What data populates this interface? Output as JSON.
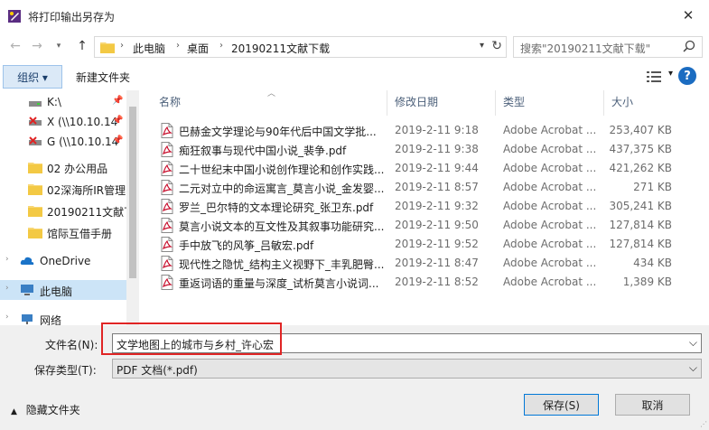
{
  "window": {
    "title": "将打印输出另存为",
    "close_glyph": "✕"
  },
  "address": {
    "crumbs": [
      "此电脑",
      "桌面",
      "20190211文献下载"
    ],
    "search_placeholder": "搜索\"20190211文献下载\""
  },
  "toolbar": {
    "organize_label": "组织 ▾",
    "new_folder_label": "新建文件夹"
  },
  "sidebar": {
    "items": [
      {
        "label": "K:\\",
        "icon": "drive-icon",
        "pinned": true
      },
      {
        "label": "X (\\\\10.10.14",
        "icon": "network-drive-icon",
        "pinned": true
      },
      {
        "label": "G (\\\\10.10.14",
        "icon": "network-drive-icon",
        "pinned": true
      },
      {
        "label": "02 办公用品",
        "icon": "folder-icon",
        "pinned": false
      },
      {
        "label": "02深海所IR管理",
        "icon": "folder-icon",
        "pinned": false
      },
      {
        "label": "20190211文献下",
        "icon": "folder-icon",
        "pinned": false
      },
      {
        "label": "馆际互借手册",
        "icon": "folder-icon",
        "pinned": false
      },
      {
        "label": "OneDrive",
        "icon": "cloud-icon",
        "pinned": false
      },
      {
        "label": "此电脑",
        "icon": "computer-icon",
        "pinned": false
      },
      {
        "label": "网络",
        "icon": "network-icon",
        "pinned": false
      }
    ]
  },
  "columns": {
    "name": "名称",
    "date": "修改日期",
    "type": "类型",
    "size": "大小"
  },
  "files": [
    {
      "name": "巴赫金文学理论与90年代后中国文学批...",
      "date": "2019-2-11 9:18",
      "type": "Adobe Acrobat ...",
      "size": "253,407 KB"
    },
    {
      "name": "痴狂叙事与现代中国小说_裴争.pdf",
      "date": "2019-2-11 9:38",
      "type": "Adobe Acrobat ...",
      "size": "437,375 KB"
    },
    {
      "name": "二十世纪末中国小说创作理论和创作实践...",
      "date": "2019-2-11 9:44",
      "type": "Adobe Acrobat ...",
      "size": "421,262 KB"
    },
    {
      "name": "二元对立中的命运寓言_莫言小说_金发婴...",
      "date": "2019-2-11 8:57",
      "type": "Adobe Acrobat ...",
      "size": "271 KB"
    },
    {
      "name": "罗兰_巴尔特的文本理论研究_张卫东.pdf",
      "date": "2019-2-11 9:32",
      "type": "Adobe Acrobat ...",
      "size": "305,241 KB"
    },
    {
      "name": "莫言小说文本的互文性及其叙事功能研究...",
      "date": "2019-2-11 9:50",
      "type": "Adobe Acrobat ...",
      "size": "127,814 KB"
    },
    {
      "name": "手中放飞的风筝_吕敏宏.pdf",
      "date": "2019-2-11 9:52",
      "type": "Adobe Acrobat ...",
      "size": "127,814 KB"
    },
    {
      "name": "现代性之隐忧_结构主义视野下_丰乳肥臀...",
      "date": "2019-2-11 8:47",
      "type": "Adobe Acrobat ...",
      "size": "434 KB"
    },
    {
      "name": "重返词语的重量与深度_试析莫言小说词...",
      "date": "2019-2-11 8:52",
      "type": "Adobe Acrobat ...",
      "size": "1,389 KB"
    }
  ],
  "form": {
    "filename_label": "文件名(N):",
    "filename_value": "文学地图上的城市与乡村_许心宏",
    "filetype_label": "保存类型(T):",
    "filetype_value": "PDF 文档(*.pdf)",
    "hide_folders_label": "隐藏文件夹",
    "save_label": "保存(S)",
    "cancel_label": "取消"
  },
  "colors": {
    "accent": "#0078d7",
    "selection": "#cce4f7",
    "highlight_box": "#e02424",
    "pdf_red": "#c8102e"
  }
}
